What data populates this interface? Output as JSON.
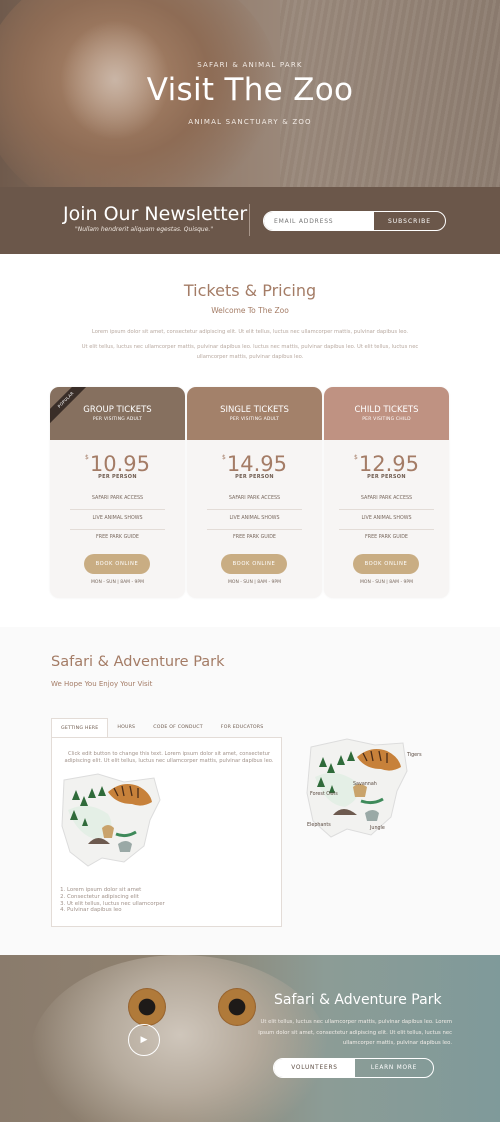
{
  "hero": {
    "eyebrow": "SAFARI & ANIMAL PARK",
    "title": "Visit The Zoo",
    "subtitle": "ANIMAL SANCTUARY & ZOO"
  },
  "newsletter": {
    "title": "Join Our Newsletter",
    "quote": "\"Nullam hendrerit aliquam egestas. Quisque.\"",
    "email_placeholder": "EMAIL ADDRESS",
    "subscribe_label": "SUBSCRIBE"
  },
  "pricing": {
    "title": "Tickets & Pricing",
    "subtitle": "Welcome To The Zoo",
    "paragraph1": "Lorem ipsum dolor sit amet, consectetur adipiscing elit. Ut elit tellus, luctus nec ullamcorper mattis, pulvinar dapibus leo.",
    "paragraph2": "Ut elit tellus, luctus nec ullamcorper mattis, pulvinar dapibus leo. luctus nec mattis, pulvinar dapibus leo. Ut elit tellus, luctus nec ullamcorper mattis, pulvinar dapibus leo.",
    "popular_badge": "POPULAR",
    "cards": [
      {
        "name": "GROUP TICKETS",
        "per": "PER VISITING ADULT",
        "currency": "$",
        "price": "10.95",
        "per_person": "PER PERSON",
        "features": [
          "SAFARI PARK ACCESS",
          "LIVE ANIMAL SHOWS",
          "FREE PARK GUIDE"
        ],
        "button": "BOOK ONLINE",
        "hours": "MON - SUN | 8AM - 9PM",
        "color": "#86705f"
      },
      {
        "name": "SINGLE TICKETS",
        "per": "PER VISITING ADULT",
        "currency": "$",
        "price": "14.95",
        "per_person": "PER PERSON",
        "features": [
          "SAFARI PARK ACCESS",
          "LIVE ANIMAL SHOWS",
          "FREE PARK GUIDE"
        ],
        "button": "BOOK ONLINE",
        "hours": "MON - SUN | 8AM - 9PM",
        "color": "#a3816a"
      },
      {
        "name": "CHILD TICKETS",
        "per": "PER VISITING CHILD",
        "currency": "$",
        "price": "12.95",
        "per_person": "PER PERSON",
        "features": [
          "SAFARI PARK ACCESS",
          "LIVE ANIMAL SHOWS",
          "FREE PARK GUIDE"
        ],
        "button": "BOOK ONLINE",
        "hours": "MON - SUN | 8AM - 9PM",
        "color": "#bf9282"
      }
    ]
  },
  "safari": {
    "title": "Safari & Adventure Park",
    "subtitle": "We Hope You Enjoy Your Visit",
    "tabs": [
      "GETTING HERE",
      "HOURS",
      "CODE OF CONDUCT",
      "FOR EDUCATORS"
    ],
    "tab_text": "Click edit button to change this text. Lorem ipsum dolor sit amet, consectetur adipiscing elit. Ut elit tellus, luctus nec ullamcorper mattis, pulvinar dapibus leo.",
    "list": [
      "Lorem ipsum dolor sit amet",
      "Consectetur adipiscing elit",
      "Ut elit tellus, luctus nec ullamcorper",
      "Pulvinar dapibus leo"
    ],
    "map_labels": [
      "Tigers",
      "Savannah",
      "Forest Owls",
      "Elephants",
      "Jungle"
    ]
  },
  "bottom": {
    "title": "Safari & Adventure Park",
    "text": "Ut elit tellus, luctus nec ullamcorper mattis, pulvinar dapibus leo. Lorem ipsum dolor sit amet, consectetur adipiscing elit. Ut elit tellus, luctus nec ullamcorper mattis, pulvinar dapibus leo.",
    "btn_volunteers": "VOLUNTEERS",
    "btn_learn": "LEARN MORE"
  }
}
